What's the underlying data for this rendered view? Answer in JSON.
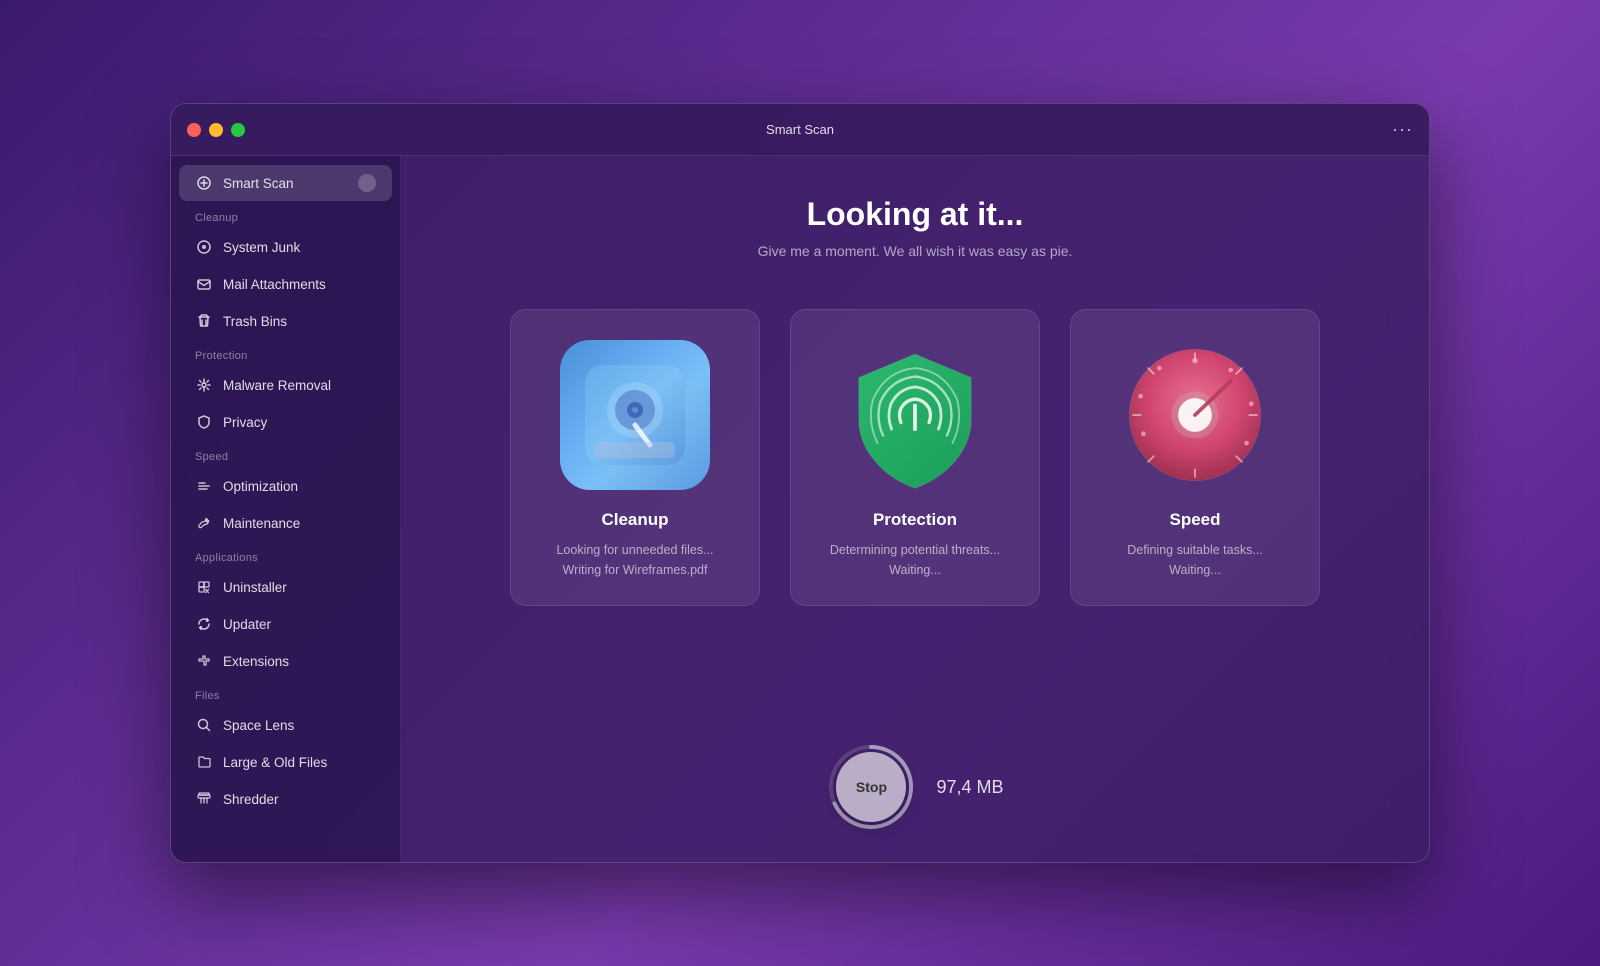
{
  "window": {
    "title": "Smart Scan",
    "dots_label": "···"
  },
  "sidebar": {
    "smart_scan_label": "Smart Scan",
    "sections": [
      {
        "name": "cleanup",
        "label": "Cleanup",
        "items": [
          {
            "id": "system-junk",
            "label": "System Junk",
            "icon": "gear"
          },
          {
            "id": "mail-attachments",
            "label": "Mail Attachments",
            "icon": "mail"
          },
          {
            "id": "trash-bins",
            "label": "Trash Bins",
            "icon": "trash"
          }
        ]
      },
      {
        "name": "protection",
        "label": "Protection",
        "items": [
          {
            "id": "malware-removal",
            "label": "Malware Removal",
            "icon": "biohazard"
          },
          {
            "id": "privacy",
            "label": "Privacy",
            "icon": "hand"
          }
        ]
      },
      {
        "name": "speed",
        "label": "Speed",
        "items": [
          {
            "id": "optimization",
            "label": "Optimization",
            "icon": "sliders"
          },
          {
            "id": "maintenance",
            "label": "Maintenance",
            "icon": "wrench"
          }
        ]
      },
      {
        "name": "applications",
        "label": "Applications",
        "items": [
          {
            "id": "uninstaller",
            "label": "Uninstaller",
            "icon": "uninstall"
          },
          {
            "id": "updater",
            "label": "Updater",
            "icon": "update"
          },
          {
            "id": "extensions",
            "label": "Extensions",
            "icon": "extensions"
          }
        ]
      },
      {
        "name": "files",
        "label": "Files",
        "items": [
          {
            "id": "space-lens",
            "label": "Space Lens",
            "icon": "lens"
          },
          {
            "id": "large-old-files",
            "label": "Large & Old Files",
            "icon": "folder"
          },
          {
            "id": "shredder",
            "label": "Shredder",
            "icon": "shredder"
          }
        ]
      }
    ]
  },
  "main": {
    "heading": "Looking at it...",
    "subheading": "Give me a moment. We all wish it was easy as pie.",
    "cards": [
      {
        "id": "cleanup",
        "title": "Cleanup",
        "status_line1": "Looking for unneeded files...",
        "status_line2": "Writing for Wireframes.pdf"
      },
      {
        "id": "protection",
        "title": "Protection",
        "status_line1": "Determining potential threats...",
        "status_line2": "Waiting..."
      },
      {
        "id": "speed",
        "title": "Speed",
        "status_line1": "Defining suitable tasks...",
        "status_line2": "Waiting..."
      }
    ],
    "stop_button_label": "Stop",
    "scan_size": "97,4 MB"
  }
}
